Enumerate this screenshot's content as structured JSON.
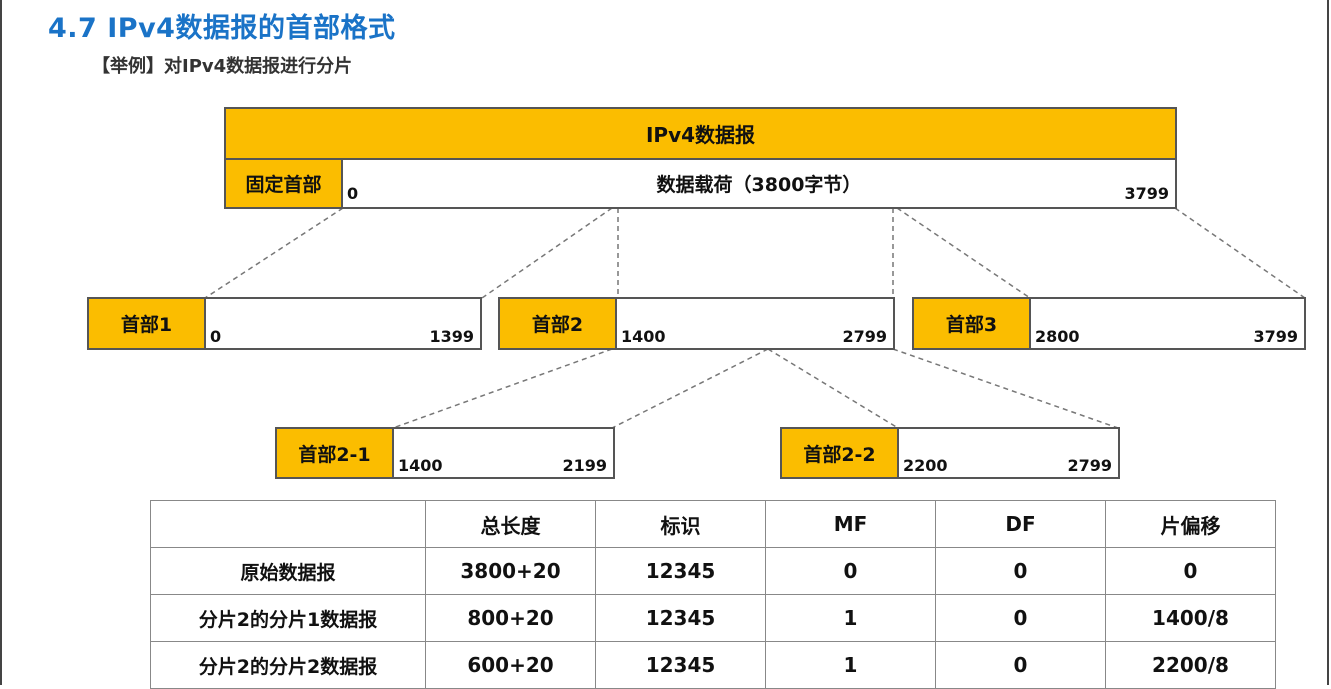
{
  "title": "4.7 IPv4数据报的首部格式",
  "subtitle": "【举例】对IPv4数据报进行分片",
  "datagram": {
    "label": "IPv4数据报",
    "header": "固定首部",
    "payload": "数据载荷（3800字节）",
    "start": "0",
    "end": "3799"
  },
  "fragments": [
    {
      "header": "首部1",
      "start": "0",
      "end": "1399"
    },
    {
      "header": "首部2",
      "start": "1400",
      "end": "2799"
    },
    {
      "header": "首部3",
      "start": "2800",
      "end": "3799"
    }
  ],
  "subfragments": [
    {
      "header": "首部2-1",
      "start": "1400",
      "end": "2199"
    },
    {
      "header": "首部2-2",
      "start": "2200",
      "end": "2799"
    }
  ],
  "table": {
    "columns": [
      "",
      "总长度",
      "标识",
      "MF",
      "DF",
      "片偏移"
    ],
    "rows": [
      [
        "原始数据报",
        "3800+20",
        "12345",
        "0",
        "0",
        "0"
      ],
      [
        "分片2的分片1数据报",
        "800+20",
        "12345",
        "1",
        "0",
        "1400/8"
      ],
      [
        "分片2的分片2数据报",
        "600+20",
        "12345",
        "1",
        "0",
        "2200/8"
      ]
    ]
  },
  "colors": {
    "title": "#1a73c7",
    "header_fill": "#fbbd00",
    "border": "#555555"
  }
}
